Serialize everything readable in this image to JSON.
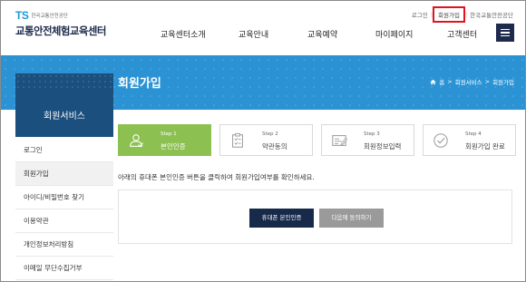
{
  "logo": {
    "ts": "TS",
    "org": "한국교통안전공단",
    "title": "교통안전체험교육센터"
  },
  "util": {
    "login": "로그인",
    "signup": "회원가입",
    "org_link": "한국교통안전공단"
  },
  "gnb": {
    "items": [
      {
        "label": "교육센터소개"
      },
      {
        "label": "교육안내"
      },
      {
        "label": "교육예약"
      },
      {
        "label": "마이페이지"
      },
      {
        "label": "고객센터"
      }
    ]
  },
  "banner": {
    "title": "회원가입",
    "breadcrumb": {
      "home": "홈",
      "section": "회원서비스",
      "current": "회원가입"
    }
  },
  "lnb": {
    "title": "회원서비스",
    "items": [
      {
        "label": "로그인"
      },
      {
        "label": "회원가입"
      },
      {
        "label": "아이디/비밀번호 찾기"
      },
      {
        "label": "이용약관"
      },
      {
        "label": "개인정보처리방침"
      },
      {
        "label": "이메일 무단수집거부"
      }
    ]
  },
  "steps": [
    {
      "num": "Step 1",
      "label": "본인인증",
      "icon": "person-icon"
    },
    {
      "num": "Step 2",
      "label": "약관동의",
      "icon": "clipboard-icon"
    },
    {
      "num": "Step 3",
      "label": "회원정보입력",
      "icon": "form-icon"
    },
    {
      "num": "Step 4",
      "label": "회원가입 완료",
      "icon": "check-circle-icon"
    }
  ],
  "notice": "아래의 휴대폰 본인인증 버튼을 클릭하여 회원가입여부를 확인하세요.",
  "buttons": {
    "auth": "휴대폰 본인인증",
    "next": "다음에 동의하기"
  },
  "colors": {
    "banner": "#2b93d4",
    "navy": "#1e2b4d",
    "step_active": "#8cc152",
    "highlight": "#e0141e"
  }
}
